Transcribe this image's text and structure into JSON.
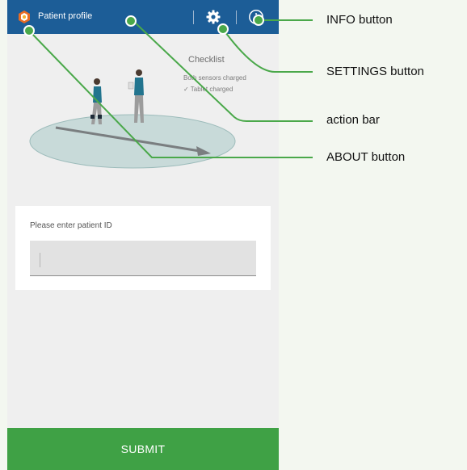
{
  "action_bar": {
    "title": "Patient profile",
    "settings_icon": "gear-icon",
    "info_icon": "info-icon",
    "background": "#1c5d97"
  },
  "illustration": {
    "checklist_title": "Checklist",
    "checklist_items": [
      "Both sensors charged",
      "Tablet charged"
    ]
  },
  "form": {
    "label": "Please enter patient ID",
    "value": "",
    "placeholder": ""
  },
  "submit_label": "SUBMIT",
  "submit_color": "#3fa145",
  "callouts": {
    "info": "INFO button",
    "settings": "SETTINGS button",
    "action_bar": "action bar",
    "about": "ABOUT button",
    "line_color": "#4aa84a"
  }
}
